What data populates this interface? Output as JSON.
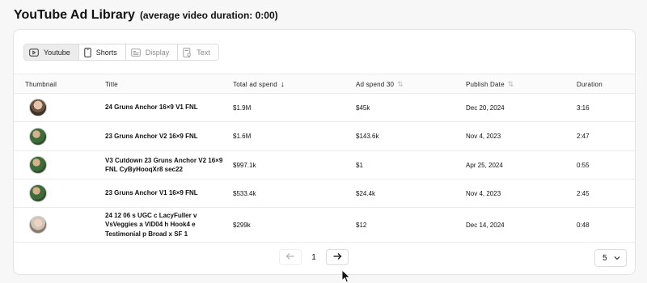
{
  "header": {
    "title": "YouTube Ad Library",
    "subtitle": "(average video duration: 0:00)"
  },
  "tabs": [
    {
      "label": "Youtube",
      "icon": "play-rect-icon",
      "active": true
    },
    {
      "label": "Shorts",
      "icon": "phone-icon",
      "active": false
    },
    {
      "label": "Display",
      "icon": "display-icon",
      "active": false
    },
    {
      "label": "Text",
      "icon": "text-doc-icon",
      "active": false
    }
  ],
  "table": {
    "columns": [
      "Thumbnail",
      "Title",
      "Total ad spend",
      "Ad spend 30",
      "Publish Date",
      "Duration"
    ],
    "rows": [
      {
        "title": "24 Gruns Anchor 16×9 V1 FNL",
        "total": "$1.9M",
        "spend30": "$45k",
        "date": "Dec 20, 2024",
        "duration": "3:16"
      },
      {
        "title": "23 Gruns Anchor V2 16×9 FNL",
        "total": "$1.6M",
        "spend30": "$143.6k",
        "date": "Nov 4, 2023",
        "duration": "2:47"
      },
      {
        "title": "V3 Cutdown 23 Gruns Anchor V2 16×9 FNL CyByHooqXr8 sec22",
        "total": "$997.1k",
        "spend30": "$1",
        "date": "Apr 25, 2024",
        "duration": "0:55"
      },
      {
        "title": "23 Gruns Anchor V1 16×9 FNL",
        "total": "$533.4k",
        "spend30": "$24.4k",
        "date": "Nov 4, 2023",
        "duration": "2:45"
      },
      {
        "title": "24 12 06 s UGC c LacyFuller v VsVeggies a VID04 h Hook4 e Testimonial p Broad x SF 1",
        "total": "$299k",
        "spend30": "$12",
        "date": "Dec 14, 2024",
        "duration": "0:48"
      }
    ]
  },
  "pagination": {
    "page": "1",
    "page_size": "5"
  }
}
